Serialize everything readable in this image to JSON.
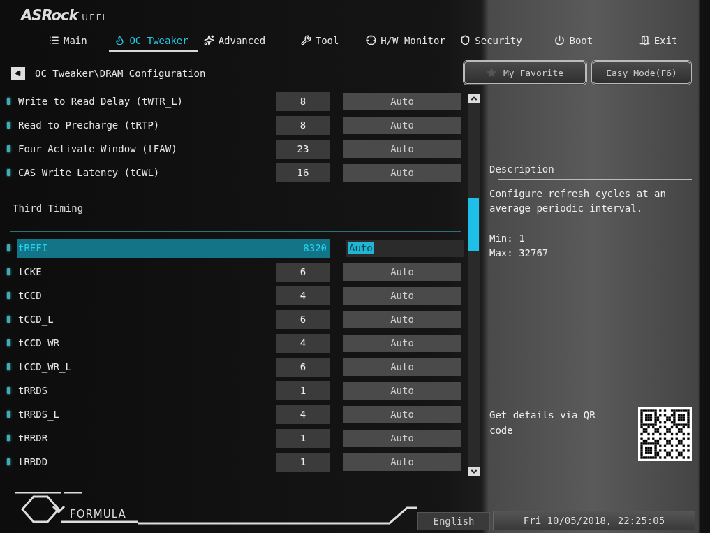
{
  "logo": {
    "brand": "ASRock",
    "suffix": "UEFI"
  },
  "tabs": [
    {
      "label": "Main",
      "selected": false
    },
    {
      "label": "OC Tweaker",
      "selected": true
    },
    {
      "label": "Advanced",
      "selected": false
    },
    {
      "label": "Tool",
      "selected": false
    },
    {
      "label": "H/W Monitor",
      "selected": false
    },
    {
      "label": "Security",
      "selected": false
    },
    {
      "label": "Boot",
      "selected": false
    },
    {
      "label": "Exit",
      "selected": false
    }
  ],
  "breadcrumb": "OC Tweaker\\DRAM Configuration",
  "buttons": [
    {
      "label": "My Favorite"
    },
    {
      "label": "Easy Mode(F6)"
    }
  ],
  "settings": [
    {
      "kind": "setting",
      "label": "Write to Read Delay (tWTR_L)",
      "value": "8",
      "option": "Auto",
      "selected": false
    },
    {
      "kind": "setting",
      "label": "Read to Precharge (tRTP)",
      "value": "8",
      "option": "Auto",
      "selected": false
    },
    {
      "kind": "setting",
      "label": "Four Activate Window (tFAW)",
      "value": "23",
      "option": "Auto",
      "selected": false
    },
    {
      "kind": "setting",
      "label": "CAS Write Latency (tCWL)",
      "value": "16",
      "option": "Auto",
      "selected": false
    },
    {
      "kind": "section",
      "label": "Third Timing"
    },
    {
      "kind": "setting",
      "label": "tREFI",
      "value": "8320",
      "option": "Auto",
      "selected": true
    },
    {
      "kind": "setting",
      "label": "tCKE",
      "value": "6",
      "option": "Auto",
      "selected": false
    },
    {
      "kind": "setting",
      "label": "tCCD",
      "value": "4",
      "option": "Auto",
      "selected": false
    },
    {
      "kind": "setting",
      "label": "tCCD_L",
      "value": "6",
      "option": "Auto",
      "selected": false
    },
    {
      "kind": "setting",
      "label": "tCCD_WR",
      "value": "4",
      "option": "Auto",
      "selected": false
    },
    {
      "kind": "setting",
      "label": "tCCD_WR_L",
      "value": "6",
      "option": "Auto",
      "selected": false
    },
    {
      "kind": "setting",
      "label": "tRRDS",
      "value": "1",
      "option": "Auto",
      "selected": false
    },
    {
      "kind": "setting",
      "label": "tRRDS_L",
      "value": "4",
      "option": "Auto",
      "selected": false
    },
    {
      "kind": "setting",
      "label": "tRRDR",
      "value": "1",
      "option": "Auto",
      "selected": false
    },
    {
      "kind": "setting",
      "label": "tRRDD",
      "value": "1",
      "option": "Auto",
      "selected": false
    }
  ],
  "description": {
    "title": "Description",
    "text": "Configure refresh cycles at an average periodic interval.",
    "min": "Min: 1",
    "max": "Max: 32767",
    "qr_text": "Get details via QR code"
  },
  "footer": {
    "logo_text": "FORMULA",
    "language": "English",
    "datetime": "Fri 10/05/2018, 22:25:05"
  }
}
